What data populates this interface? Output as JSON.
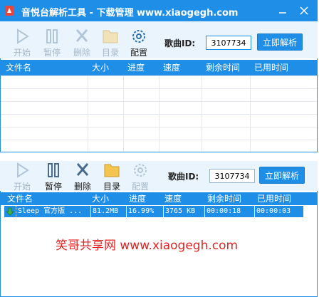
{
  "top_window": {
    "title": "音悦台解析工具 - 下载管理  www.xiaogegh.com",
    "toolbar": [
      {
        "label": "开始",
        "icon": "play-icon",
        "enabled": false
      },
      {
        "label": "暂停",
        "icon": "pause-icon",
        "enabled": false
      },
      {
        "label": "删除",
        "icon": "delete-icon",
        "enabled": false
      },
      {
        "label": "目录",
        "icon": "folder-icon",
        "enabled": false
      },
      {
        "label": "配置",
        "icon": "gear-icon",
        "enabled": true
      }
    ],
    "song_id_label": "歌曲ID:",
    "song_id_value": "3107734",
    "parse_button": "立即解析",
    "columns": [
      "文件名",
      "大小",
      "进度",
      "速度",
      "剩余时间",
      "已用时间"
    ]
  },
  "bottom_window": {
    "toolbar": [
      {
        "label": "开始",
        "icon": "play-icon",
        "enabled": false
      },
      {
        "label": "暂停",
        "icon": "pause-icon",
        "enabled": true
      },
      {
        "label": "删除",
        "icon": "delete-icon",
        "enabled": true
      },
      {
        "label": "目录",
        "icon": "folder-icon",
        "enabled": true
      },
      {
        "label": "配置",
        "icon": "gear-icon",
        "enabled": false
      }
    ],
    "song_id_label": "歌曲ID:",
    "song_id_value": "3107734",
    "parse_button": "立即解析",
    "columns": [
      "文件名",
      "大小",
      "进度",
      "速度",
      "剩余时间",
      "已用时间"
    ],
    "rows": [
      {
        "name": "Sleep 官方版 ...",
        "size": "81.2MB",
        "progress": "16.99%",
        "speed": "3765 KB",
        "remaining": "00:00:18",
        "elapsed": "00:00:03",
        "status_icon": "download-arrow-icon"
      }
    ],
    "watermark": "笑哥共享网  www.xiaogegh.com"
  },
  "colors": {
    "accent": "#1e8ee6",
    "toolbar_bg": "#eaf4fc",
    "watermark": "#e02424",
    "disabled_label": "#a7b8c8"
  }
}
